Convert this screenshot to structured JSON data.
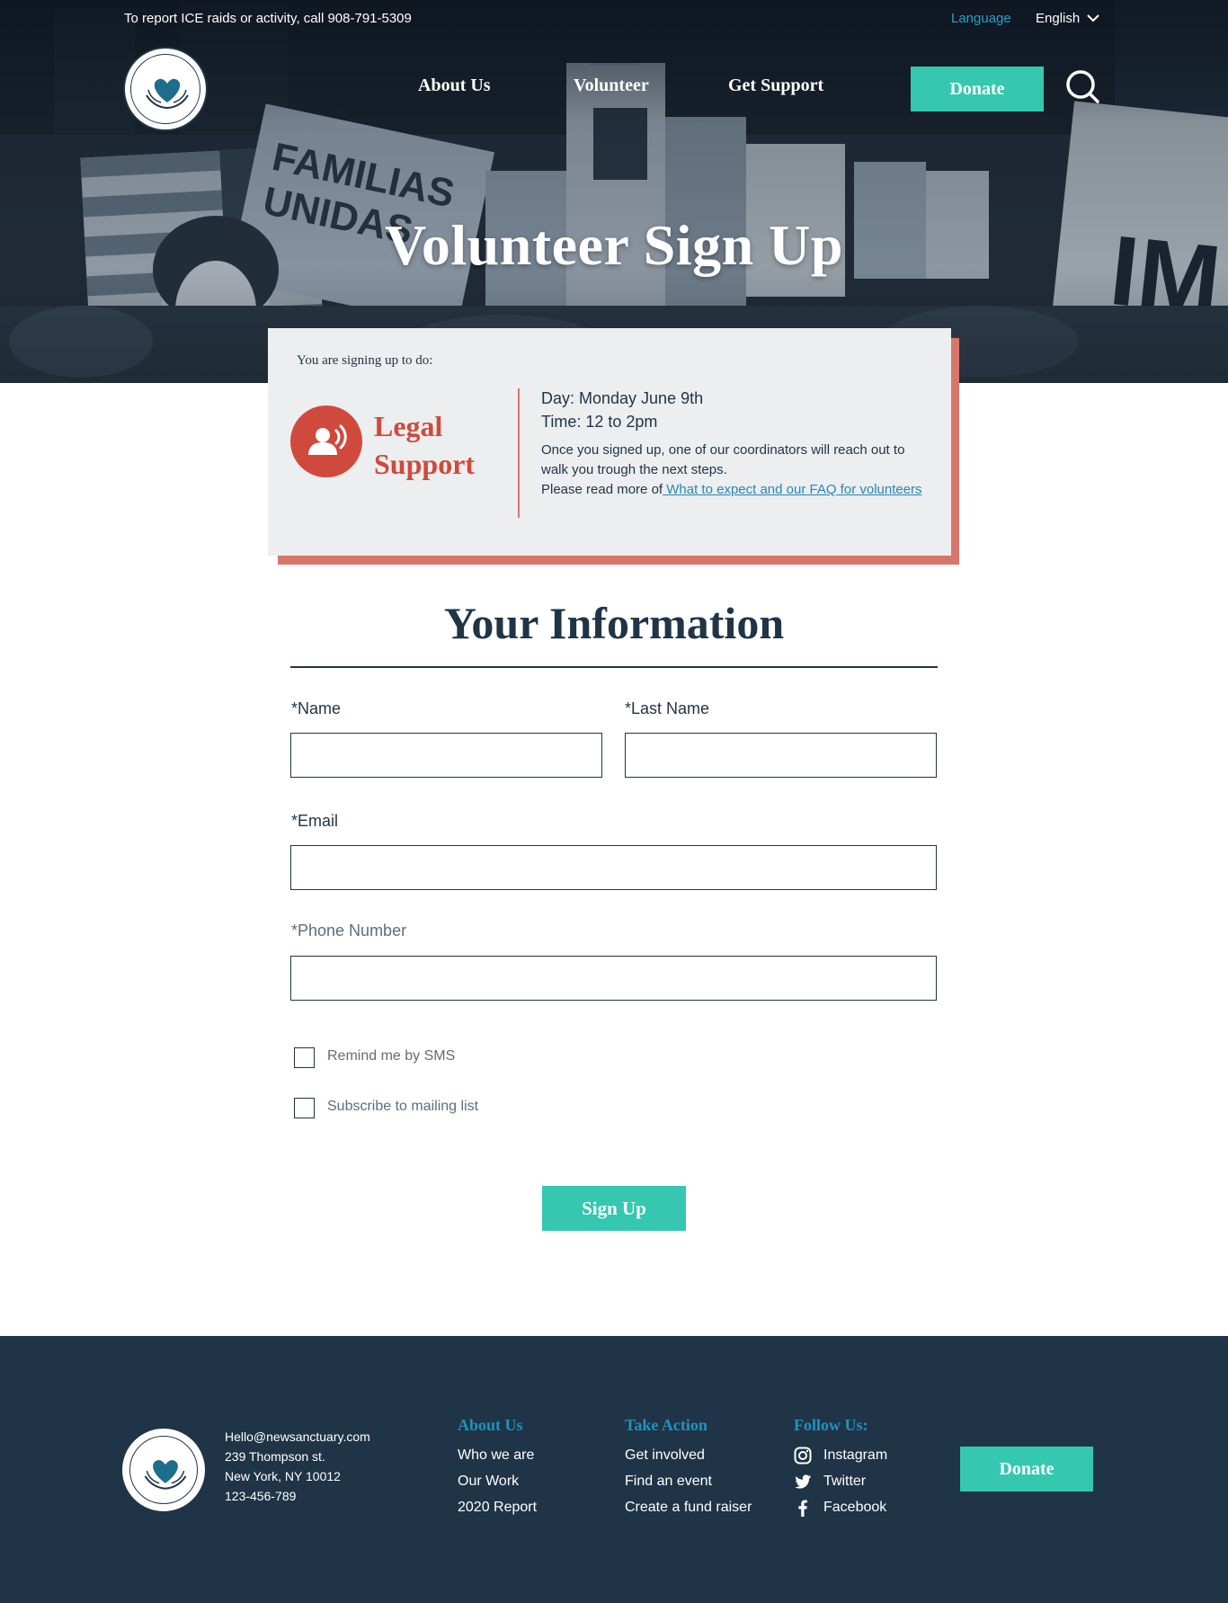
{
  "topbar": {
    "report_text": "To report ICE raids or activity, call 908-791-5309",
    "language_label": "Language",
    "language_value": "English"
  },
  "nav": {
    "items": [
      {
        "label": "About Us"
      },
      {
        "label": "Volunteer"
      },
      {
        "label": "Get Support"
      }
    ],
    "active": "Volunteer",
    "donate_label": "Donate",
    "search_icon": "search-icon"
  },
  "hero": {
    "title": "Volunteer Sign Up"
  },
  "signup_card": {
    "intro": "You are signing up to do:",
    "role": "Legal Support",
    "role_icon": "speaking-person-icon",
    "day": "Day: Monday June 9th",
    "time": "Time: 12 to 2pm",
    "note": "Once you signed up, one of our coordinators will reach out to walk you trough the next steps.",
    "read_more_prefix": "Please read more of",
    "read_more_link": " What to expect and our FAQ for volunteers"
  },
  "form": {
    "title": "Your Information",
    "name_label": "*Name",
    "name_value": "",
    "last_name_label": "*Last Name",
    "last_name_value": "",
    "email_label": "*Email",
    "email_value": "",
    "phone_label": "*Phone Number",
    "phone_value": "",
    "sms_label": "Remind me by SMS",
    "sms_checked": false,
    "mailing_label": "Subscribe to mailing list",
    "mailing_checked": false,
    "submit_label": "Sign Up"
  },
  "footer": {
    "email": "Hello@newsanctuary.com",
    "address_line1": "239 Thompson st.",
    "address_line2": "New York, NY 10012",
    "phone": "123-456-789",
    "about": {
      "heading": "About Us",
      "links": [
        "Who we are",
        "Our Work",
        "2020 Report"
      ]
    },
    "action": {
      "heading": "Take Action",
      "links": [
        "Get involved",
        "Find an event",
        "Create a fund raiser"
      ]
    },
    "follow": {
      "heading": "Follow Us:",
      "links": [
        {
          "label": "Instagram",
          "icon": "instagram-icon"
        },
        {
          "label": "Twitter",
          "icon": "twitter-icon"
        },
        {
          "label": "Facebook",
          "icon": "facebook-icon"
        }
      ]
    },
    "donate_label": "Donate"
  },
  "colors": {
    "accent": "#35c7b0",
    "brand_dark": "#1f3447",
    "link_blue": "#1f93bd",
    "role_red": "#cf4a3d",
    "card_shadow": "#d9766b"
  }
}
